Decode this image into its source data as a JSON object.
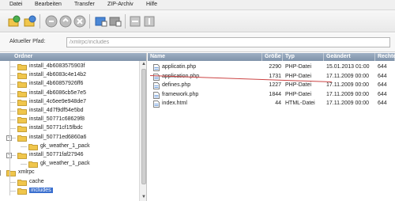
{
  "menu": [
    "Datei",
    "Bearbeiten",
    "Transfer",
    "ZIP-Archiv",
    "Hilfe"
  ],
  "toolbar": {
    "buttons": [
      "connect-icon",
      "refresh-icon",
      "disconnect-icon",
      "stop-icon",
      "cancel-icon",
      "upload-icon",
      "download-icon",
      "zip-icon",
      "unzip-icon"
    ]
  },
  "path": {
    "label": "Aktueller Pfad:",
    "value": "/xmlrpc/includes"
  },
  "tree": {
    "header": "Ordner",
    "items": [
      {
        "label": "install_4b6083575903f",
        "level": 1,
        "has_expander": false
      },
      {
        "label": "install_4b6083c4e14b2",
        "level": 1,
        "has_expander": false
      },
      {
        "label": "install_4b60857926ff6",
        "level": 1,
        "has_expander": false
      },
      {
        "label": "install_4b6086cb5e7e5",
        "level": 1,
        "has_expander": false
      },
      {
        "label": "install_4c6ee9e948de7",
        "level": 1,
        "has_expander": false
      },
      {
        "label": "install_4d7f9df54e5bd",
        "level": 1,
        "has_expander": false
      },
      {
        "label": "install_50771c68629f8",
        "level": 1,
        "has_expander": false
      },
      {
        "label": "install_50771cf15fbdc",
        "level": 1,
        "has_expander": false
      },
      {
        "label": "install_50771ed6860a6",
        "level": 1,
        "has_expander": true
      },
      {
        "label": "gk_weather_1_pack",
        "level": 2,
        "has_expander": false
      },
      {
        "label": "install_50771faf27946",
        "level": 1,
        "has_expander": true
      },
      {
        "label": "gk_weather_1_pack",
        "level": 2,
        "has_expander": false
      },
      {
        "label": "xmlrpc",
        "level": 0,
        "has_expander": true
      },
      {
        "label": "cache",
        "level": 1,
        "has_expander": false
      },
      {
        "label": "includes",
        "level": 1,
        "has_expander": false,
        "selected": true
      }
    ]
  },
  "files": {
    "columns": [
      "Name",
      "Größe",
      "Typ",
      "Geändert",
      "Rechte"
    ],
    "rows": [
      {
        "name": "applicatin.php",
        "size": "2290",
        "type": "PHP-Datei",
        "modified": "15.01.2013 01:00",
        "rights": "644"
      },
      {
        "name": "application.php",
        "size": "1731",
        "type": "PHP-Datei",
        "modified": "17.11.2009 00:00",
        "rights": "644"
      },
      {
        "name": "defines.php",
        "size": "1227",
        "type": "PHP-Datei",
        "modified": "17.11.2009 00:00",
        "rights": "644"
      },
      {
        "name": "framework.php",
        "size": "1844",
        "type": "PHP-Datei",
        "modified": "17.11.2009 00:00",
        "rights": "644"
      },
      {
        "name": "index.html",
        "size": "44",
        "type": "HTML-Datei",
        "modified": "17.11.2009 00:00",
        "rights": "644"
      }
    ]
  },
  "colors": {
    "selection": "#3a6fcf",
    "header": "#8fa1b7",
    "folder": "#f0c64c",
    "annotation": "#cc4444"
  }
}
